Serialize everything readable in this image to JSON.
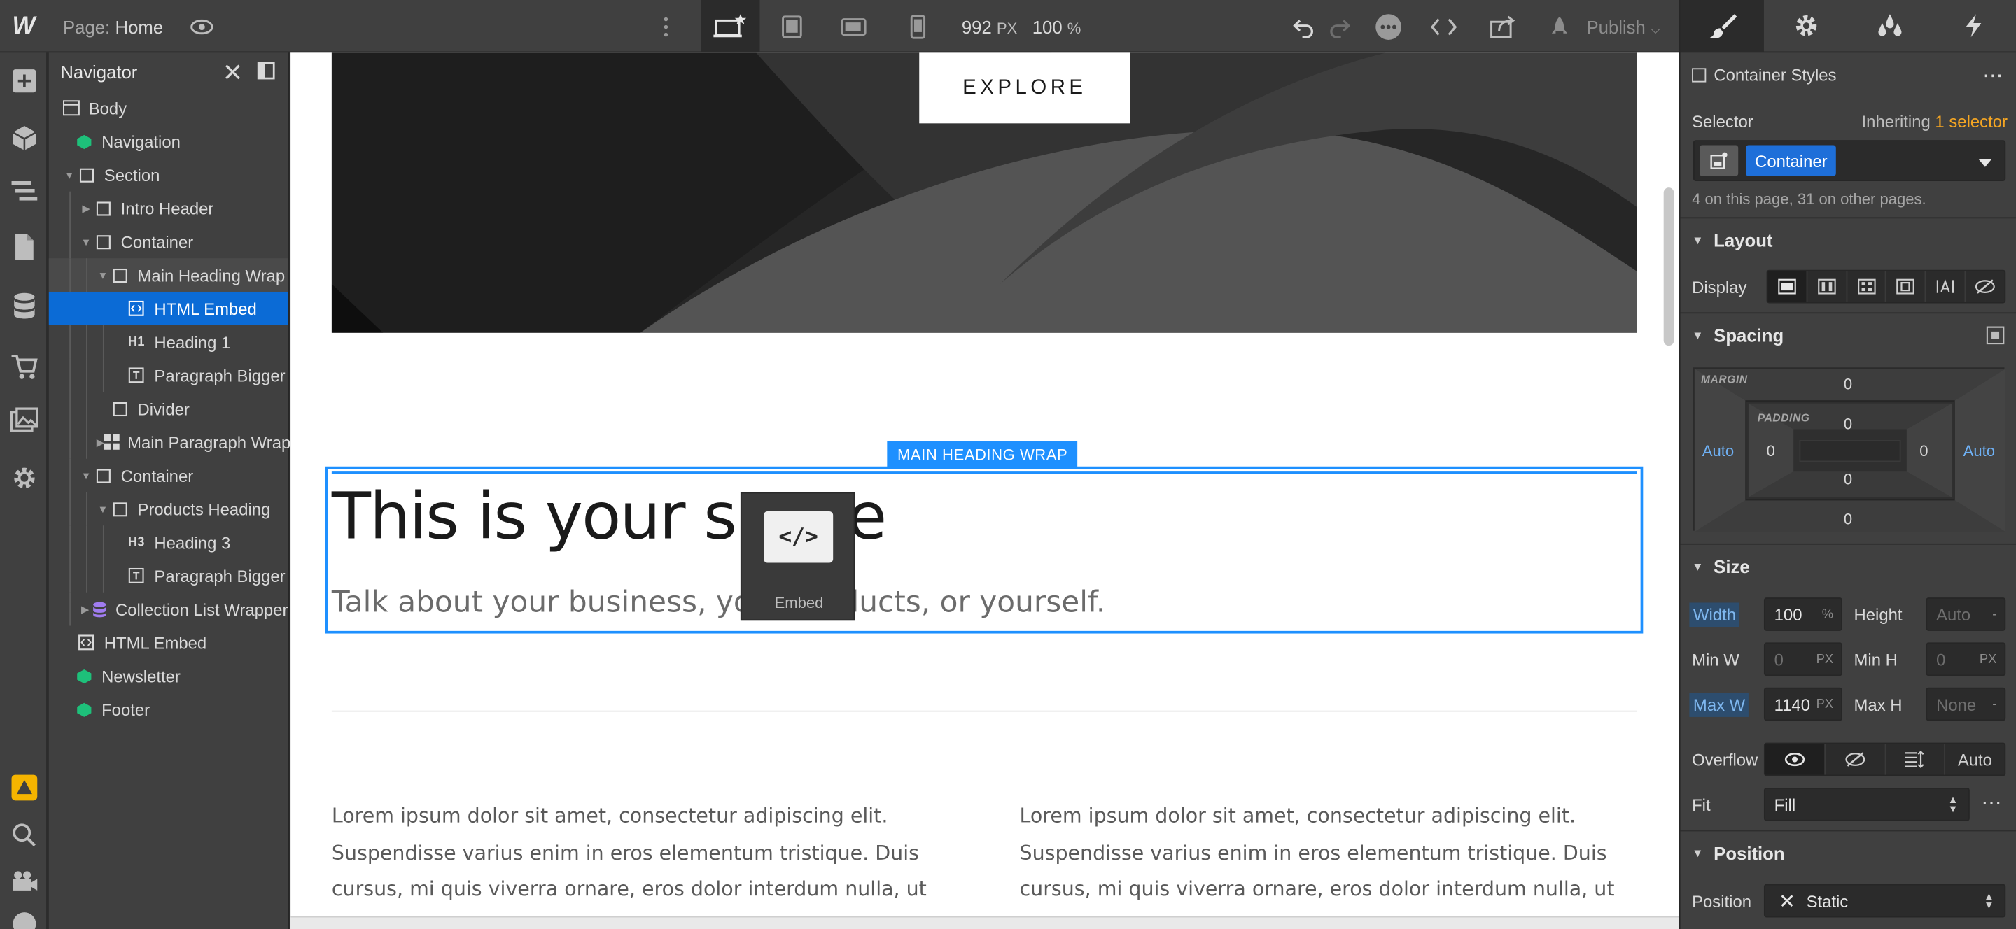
{
  "topbar": {
    "logo": "W",
    "page_prefix": "Page:",
    "page_name": "Home",
    "width_value": "992",
    "width_unit": "PX",
    "zoom": "100",
    "zoom_unit": "%",
    "publish_label": "Publish"
  },
  "navigator": {
    "title": "Navigator",
    "items": [
      {
        "label": "Body",
        "icon": "body-icon"
      },
      {
        "label": "Navigation",
        "icon": "symbol-icon"
      },
      {
        "label": "Section",
        "icon": "box-icon"
      },
      {
        "label": "Intro Header",
        "icon": "box-icon"
      },
      {
        "label": "Container",
        "icon": "box-icon"
      },
      {
        "label": "Main Heading Wrap",
        "icon": "box-icon"
      },
      {
        "label": "HTML Embed",
        "icon": "embed-icon"
      },
      {
        "label": "Heading 1",
        "icon": "h1-icon"
      },
      {
        "label": "Paragraph Bigger",
        "icon": "paragraph-icon"
      },
      {
        "label": "Divider",
        "icon": "box-icon"
      },
      {
        "label": "Main Paragraph Wrap",
        "icon": "grid-icon"
      },
      {
        "label": "Container",
        "icon": "box-icon"
      },
      {
        "label": "Products Heading",
        "icon": "box-icon"
      },
      {
        "label": "Heading 3",
        "icon": "h3-icon"
      },
      {
        "label": "Paragraph Bigger",
        "icon": "paragraph-icon"
      },
      {
        "label": "Collection List Wrapper",
        "icon": "collection-icon"
      },
      {
        "label": "HTML Embed",
        "icon": "embed-icon"
      },
      {
        "label": "Newsletter",
        "icon": "symbol-icon"
      },
      {
        "label": "Footer",
        "icon": "symbol-icon"
      }
    ]
  },
  "canvas": {
    "explore_button": "EXPLORE",
    "selection_tag": "MAIN HEADING WRAP",
    "heading": "This is your space",
    "paragraph": "Talk about your business, your products, or yourself.",
    "embed_icon_text": "</>",
    "embed_label": "Embed",
    "lorem_left": "Lorem ipsum dolor sit amet, consectetur adipiscing elit. Suspendisse varius enim in eros elementum tristique. Duis cursus, mi quis viverra ornare, eros dolor interdum nulla, ut",
    "lorem_right": "Lorem ipsum dolor sit amet, consectetur adipiscing elit. Suspendisse varius enim in eros elementum tristique. Duis cursus, mi quis viverra ornare, eros dolor interdum nulla, ut"
  },
  "style_panel": {
    "title": "Container Styles",
    "selector_label": "Selector",
    "inheriting_prefix": "Inheriting",
    "inheriting_link": "1 selector",
    "selector_chip": "Container",
    "usage_note": "4 on this page, 31 on other pages.",
    "layout": {
      "title": "Layout",
      "display_label": "Display"
    },
    "spacing": {
      "title": "Spacing",
      "margin_caption": "MARGIN",
      "padding_caption": "PADDING",
      "margin_top": "0",
      "margin_bottom": "0",
      "margin_left": "Auto",
      "margin_right": "Auto",
      "padding_top": "0",
      "padding_bottom": "0",
      "padding_left": "0",
      "padding_right": "0"
    },
    "size": {
      "title": "Size",
      "width_label": "Width",
      "width_value": "100",
      "width_unit": "%",
      "height_label": "Height",
      "height_value": "Auto",
      "height_unit": "-",
      "minw_label": "Min W",
      "minw_value": "0",
      "minw_unit": "PX",
      "minh_label": "Min H",
      "minh_value": "0",
      "minh_unit": "PX",
      "maxw_label": "Max W",
      "maxw_value": "1140",
      "maxw_unit": "PX",
      "maxh_label": "Max H",
      "maxh_value": "None",
      "maxh_unit": "-",
      "overflow_label": "Overflow",
      "overflow_auto": "Auto",
      "fit_label": "Fit",
      "fit_value": "Fill"
    },
    "position": {
      "title": "Position",
      "position_label": "Position",
      "position_value": "Static"
    }
  },
  "colors": {
    "accent": "#1e90ff",
    "selected_row": "#0b6bd6",
    "inheriting_link": "#f5a623",
    "chip": "#1e6fd9"
  }
}
